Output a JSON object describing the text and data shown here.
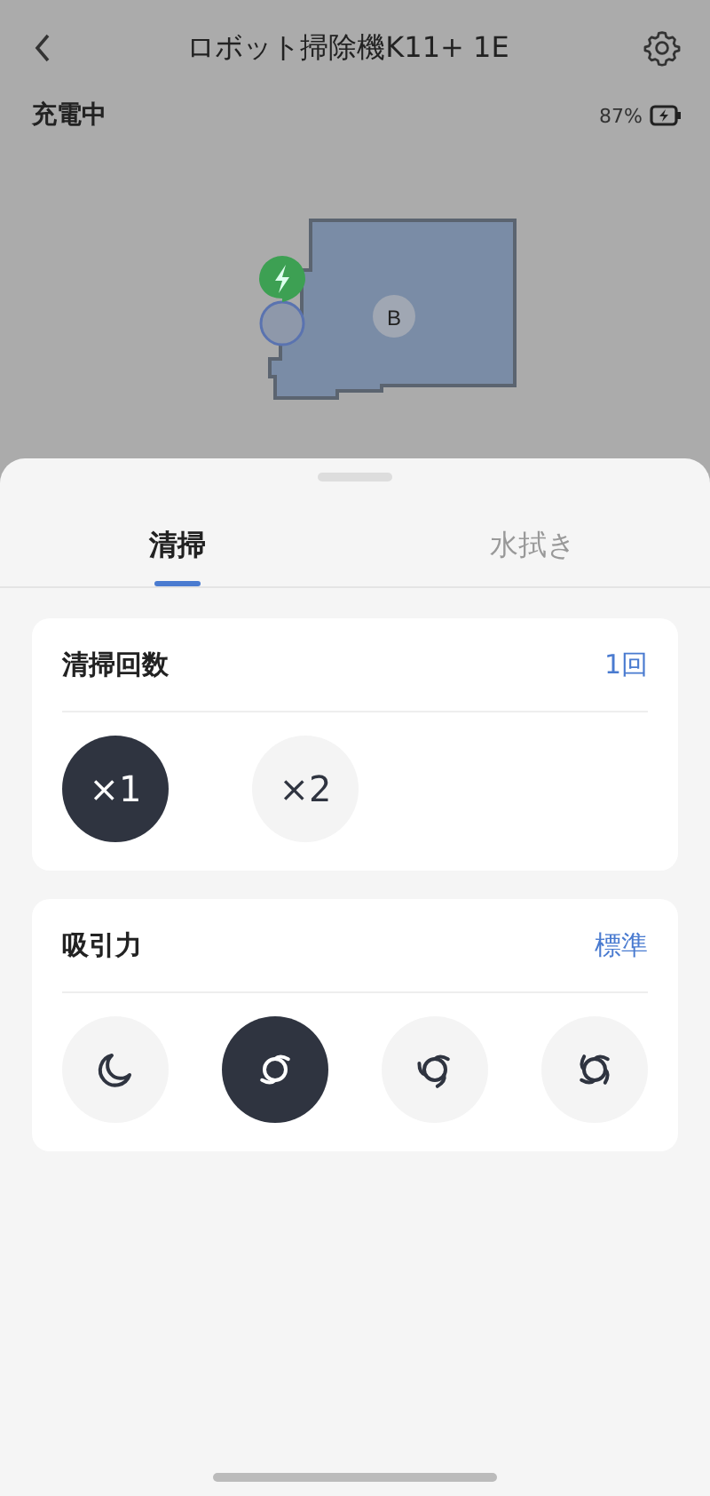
{
  "header": {
    "title": "ロボット掃除機K11+ 1E"
  },
  "status": {
    "state": "充電中",
    "battery": "87%",
    "charging": true
  },
  "map": {
    "room_label": "B"
  },
  "tabs": [
    {
      "label": "清掃",
      "selected": true
    },
    {
      "label": "水拭き",
      "selected": false
    }
  ],
  "sections": [
    {
      "title": "清掃回数",
      "value": "1回",
      "options": [
        {
          "kind": "text",
          "label": "×1",
          "selected": true
        },
        {
          "kind": "text",
          "label": "×2",
          "selected": false
        }
      ]
    },
    {
      "title": "吸引力",
      "value": "標準",
      "options": [
        {
          "kind": "quiet",
          "selected": false
        },
        {
          "kind": "fan2",
          "selected": true
        },
        {
          "kind": "fan3",
          "selected": false
        },
        {
          "kind": "fan4",
          "selected": false
        }
      ]
    }
  ]
}
